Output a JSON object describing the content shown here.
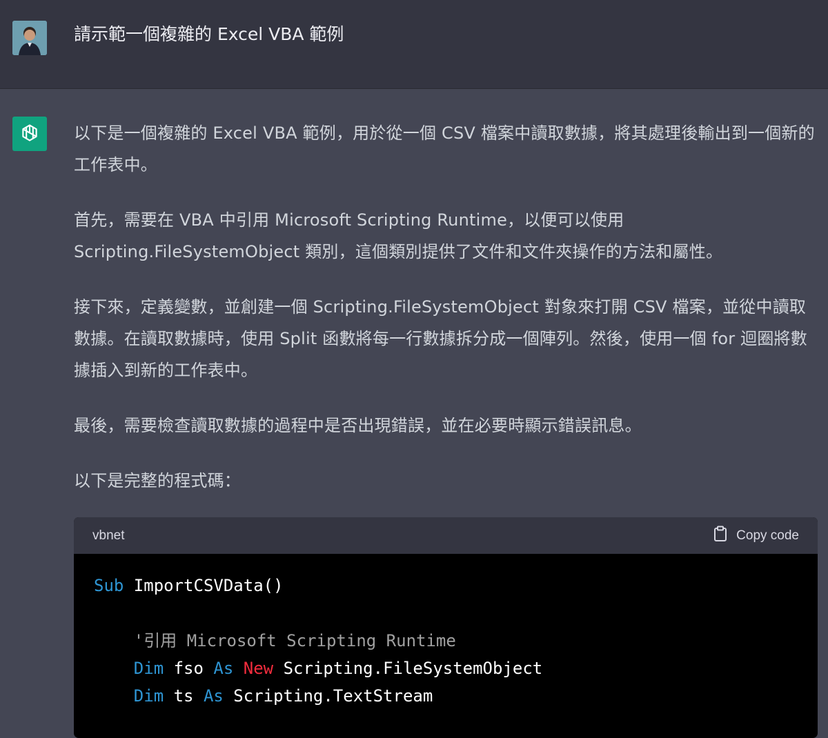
{
  "user": {
    "message": "請示範一個複雜的 Excel VBA 範例"
  },
  "assistant": {
    "paragraphs": [
      "以下是一個複雜的 Excel VBA 範例，用於從一個 CSV 檔案中讀取數據，將其處理後輸出到一個新的工作表中。",
      "首先，需要在 VBA 中引用 Microsoft Scripting Runtime，以便可以使用 Scripting.FileSystemObject 類別，這個類別提供了文件和文件夾操作的方法和屬性。",
      "接下來，定義變數，並創建一個 Scripting.FileSystemObject 對象來打開 CSV 檔案，並從中讀取數據。在讀取數據時，使用 Split 函數將每一行數據拆分成一個陣列。然後，使用一個 for 迴圈將數據插入到新的工作表中。",
      "最後，需要檢查讀取數據的過程中是否出現錯誤，並在必要時顯示錯誤訊息。",
      "以下是完整的程式碼："
    ]
  },
  "code": {
    "language": "vbnet",
    "copy_label": "Copy code",
    "lines": {
      "l1_kw": "Sub",
      "l1_rest": " ImportCSVData()",
      "l3_comment": "'引用 Microsoft Scripting Runtime",
      "l4_dim": "Dim",
      "l4_var": " fso ",
      "l4_as": "As",
      "l4_new": "New",
      "l4_type": " Scripting.FileSystemObject",
      "l5_dim": "Dim",
      "l5_var": " ts ",
      "l5_as": "As",
      "l5_type": " Scripting.TextStream"
    }
  },
  "colors": {
    "page_bg": "#444654",
    "user_bg": "#343541",
    "accent_green": "#10a37f",
    "keyword_blue": "#2e95d3",
    "keyword_new": "#f22c3d"
  },
  "icons": {
    "avatar": "user-avatar",
    "assistant": "openai-logo-icon",
    "copy": "clipboard-icon"
  }
}
